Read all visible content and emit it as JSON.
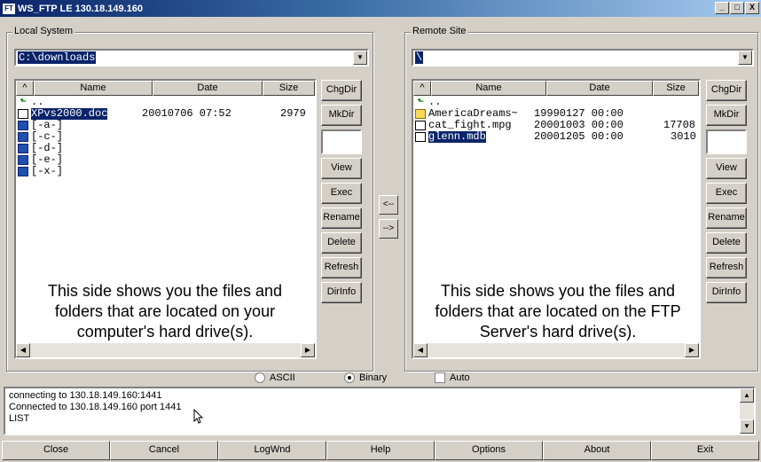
{
  "window": {
    "title": "WS_FTP LE 130.18.149.160",
    "app_icon": "FT",
    "buttons": [
      "_",
      "□",
      "X"
    ]
  },
  "local": {
    "group_label": "Local System",
    "path": "C:\\downloads",
    "columns": [
      "Name",
      "Date",
      "Size"
    ],
    "sort_indicator": "^",
    "files": [
      {
        "icon": "up-arrow-icon",
        "name": "..",
        "date": "",
        "size": "",
        "selected": false
      },
      {
        "icon": "file-icon",
        "name": "XPvs2000.doc",
        "date": "20010706 07:52",
        "size": "2979",
        "selected": true
      },
      {
        "icon": "drive-icon",
        "name": "[-a-]",
        "date": "",
        "size": "",
        "selected": false
      },
      {
        "icon": "drive-icon",
        "name": "[-c-]",
        "date": "",
        "size": "",
        "selected": false
      },
      {
        "icon": "drive-icon",
        "name": "[-d-]",
        "date": "",
        "size": "",
        "selected": false
      },
      {
        "icon": "drive-icon",
        "name": "[-e-]",
        "date": "",
        "size": "",
        "selected": false
      },
      {
        "icon": "drive-icon",
        "name": "[-x-]",
        "date": "",
        "size": "",
        "selected": false
      }
    ],
    "hint": "This side shows you the files and folders that are located on your computer's hard drive(s).",
    "buttons": [
      "ChgDir",
      "MkDir",
      "View",
      "Exec",
      "Rename",
      "Delete",
      "Refresh",
      "DirInfo"
    ]
  },
  "remote": {
    "group_label": "Remote Site",
    "path": "\\",
    "columns": [
      "Name",
      "Date",
      "Size"
    ],
    "sort_indicator": "^",
    "files": [
      {
        "icon": "up-arrow-icon",
        "name": "..",
        "date": "",
        "size": "",
        "selected": false
      },
      {
        "icon": "folder-icon",
        "name": "AmericaDreams~",
        "date": "19990127 00:00",
        "size": "",
        "selected": false
      },
      {
        "icon": "file-icon",
        "name": "cat_fight.mpg",
        "date": "20001003 00:00",
        "size": "17708",
        "selected": false
      },
      {
        "icon": "file-icon",
        "name": "glenn.mdb",
        "date": "20001205 00:00",
        "size": "3010",
        "selected": true
      }
    ],
    "hint": "This side shows you the files and folders that are located on the FTP Server's hard drive(s).",
    "buttons": [
      "ChgDir",
      "MkDir",
      "View",
      "Exec",
      "Rename",
      "Delete",
      "Refresh",
      "DirInfo"
    ]
  },
  "transfer": {
    "download": "<--",
    "upload": "-->"
  },
  "mode": {
    "ascii": "ASCII",
    "binary": "Binary",
    "auto": "Auto",
    "selected": "binary",
    "auto_checked": false
  },
  "log": {
    "lines": [
      "connecting to 130.18.149.160:1441",
      "Connected to 130.18.149.160 port 1441",
      "LIST"
    ]
  },
  "bottom_buttons": [
    "Close",
    "Cancel",
    "LogWnd",
    "Help",
    "Options",
    "About",
    "Exit"
  ]
}
